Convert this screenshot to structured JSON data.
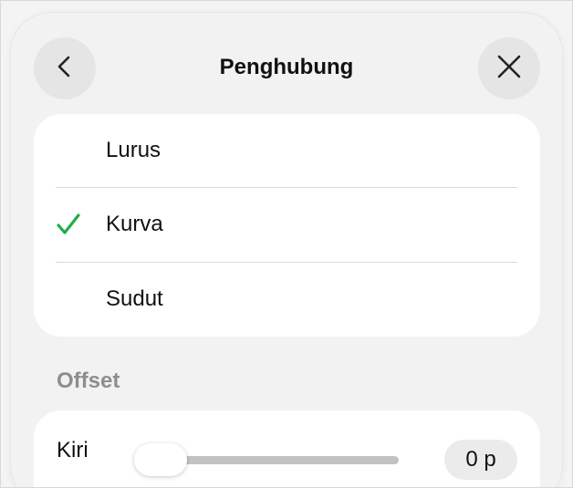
{
  "header": {
    "title": "Penghubung",
    "back_icon": "chevron-left-icon",
    "close_icon": "close-icon"
  },
  "connection_options": [
    {
      "label": "Lurus",
      "selected": false
    },
    {
      "label": "Kurva",
      "selected": true
    },
    {
      "label": "Sudut",
      "selected": false
    }
  ],
  "check_color": "#1fae4a",
  "offset": {
    "section_title": "Offset",
    "left": {
      "label": "Kiri",
      "value": "0 p",
      "slider_level": 0
    }
  }
}
